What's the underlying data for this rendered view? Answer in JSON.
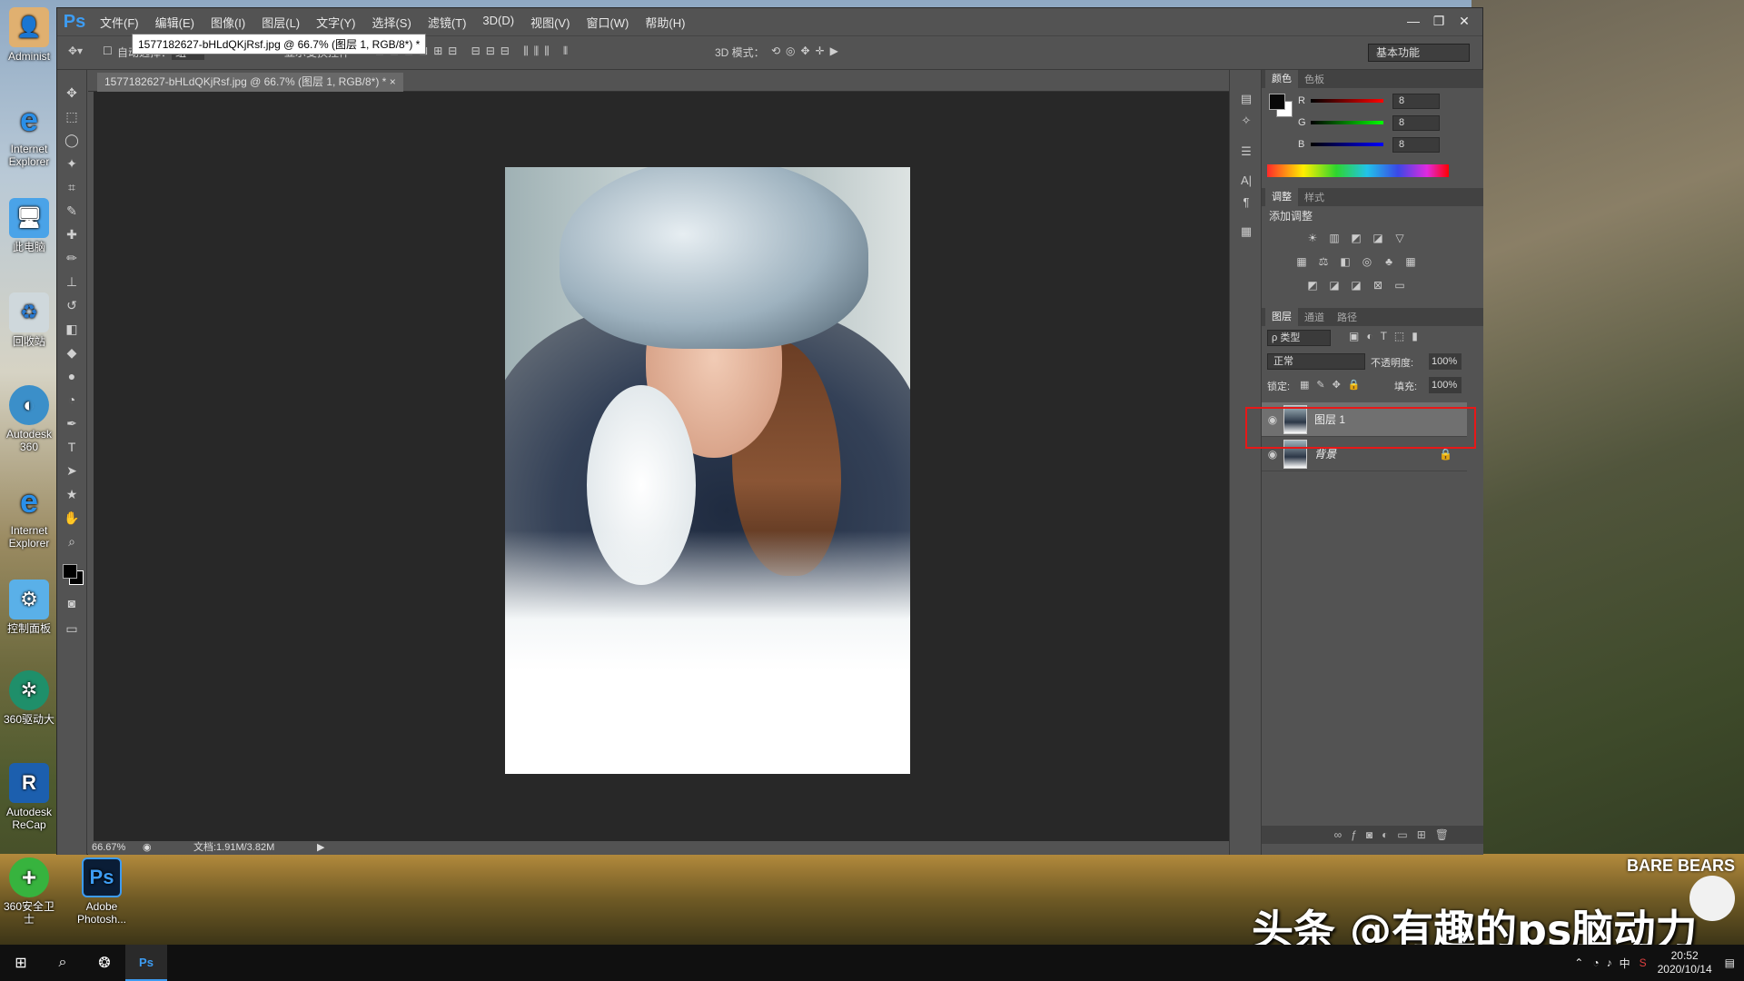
{
  "colors": {
    "ps_accent": "#3d9cf2",
    "highlight_box": "#e81818",
    "panel_bg": "#535353",
    "canvas_bg": "#282828"
  },
  "desktop": {
    "icons": [
      {
        "label": "Administ",
        "icon": "user-icon"
      },
      {
        "label": "Internet Explorer",
        "icon": "ie-icon"
      },
      {
        "label": "此电脑",
        "icon": "computer-icon"
      },
      {
        "label": "回收站",
        "icon": "recycle-bin-icon"
      },
      {
        "label": "Autodesk 360",
        "icon": "autodesk-icon"
      },
      {
        "label": "Internet Explorer",
        "icon": "ie-icon"
      },
      {
        "label": "控制面板",
        "icon": "control-panel-icon"
      },
      {
        "label": "360驱动大",
        "icon": "driver-icon"
      },
      {
        "label": "Autodesk ReCap",
        "icon": "recap-icon"
      },
      {
        "label": "360安全卫士",
        "icon": "shield-icon"
      },
      {
        "label": "Adobe Photosh...",
        "icon": "photoshop-icon"
      }
    ]
  },
  "app": {
    "logo": "Ps",
    "menu": [
      "文件(F)",
      "编辑(E)",
      "图像(I)",
      "图层(L)",
      "文字(Y)",
      "选择(S)",
      "滤镜(T)",
      "3D(D)",
      "视图(V)",
      "窗口(W)",
      "帮助(H)"
    ],
    "window_controls": {
      "minimize": "—",
      "restore": "❐",
      "close": "✕"
    }
  },
  "options": {
    "auto_select": "自动选择：",
    "auto_select_value": "组",
    "show_transform": "显示变换控件",
    "mode_3d": "3D 模式：",
    "workspace": "基本功能"
  },
  "document": {
    "tooltip": "1577182627-bHLdQKjRsf.jpg @ 66.7% (图层 1, RGB/8*) *",
    "tab": "1577182627-bHLdQKjRsf.jpg @ 66.7% (图层 1, RGB/8*) *",
    "tab_close": "×",
    "zoom": "66.67%",
    "doc_info": "文档:1.91M/3.82M"
  },
  "color_panel": {
    "tabs": [
      "颜色",
      "色板"
    ],
    "r_label": "R",
    "g_label": "G",
    "b_label": "B",
    "r": "8",
    "g": "8",
    "b": "8"
  },
  "adjust_panel": {
    "tabs": [
      "调整",
      "样式"
    ],
    "title": "添加调整"
  },
  "layers_panel": {
    "tabs": [
      "图层",
      "通道",
      "路径"
    ],
    "filter": "ρ 类型",
    "blend_mode": "正常",
    "opacity_label": "不透明度:",
    "opacity": "100%",
    "lock_label": "锁定:",
    "fill_label": "填充:",
    "fill": "100%",
    "layers": [
      {
        "name": "图层 1",
        "selected": true
      },
      {
        "name": "背景",
        "selected": false,
        "locked": true
      }
    ]
  },
  "taskbar": {
    "time": "20:52",
    "date": "2020/10/14",
    "ime": "中"
  },
  "watermark": "头条 @有趣的ps脑动力",
  "sticker": "BARE BEARS"
}
